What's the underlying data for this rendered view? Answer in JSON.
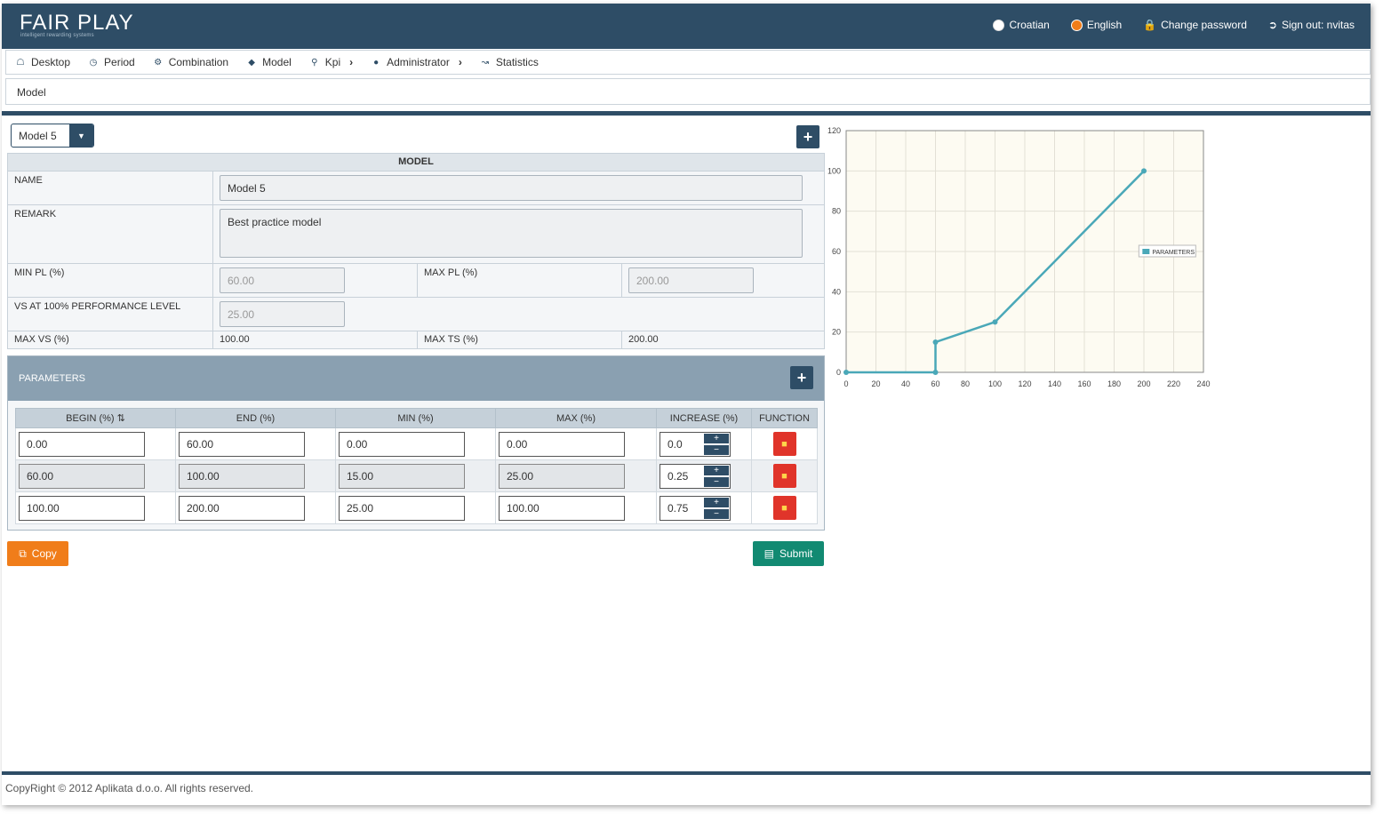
{
  "app": {
    "logo": "FAIR PLAY",
    "logo_sub": "intelligent rewarding systems"
  },
  "header": {
    "lang_croatian": "Croatian",
    "lang_english": "English",
    "change_password": "Change password",
    "sign_out": "Sign out: nvitas"
  },
  "menu": {
    "desktop": "Desktop",
    "period": "Period",
    "combination": "Combination",
    "model": "Model",
    "kpi": "Kpi",
    "administrator": "Administrator",
    "statistics": "Statistics"
  },
  "breadcrumb": "Model",
  "model_select": {
    "value": "Model 5"
  },
  "model_table": {
    "title": "MODEL",
    "name_label": "NAME",
    "name_value": "Model 5",
    "remark_label": "REMARK",
    "remark_value": "Best practice model",
    "min_pl_label": "MIN PL (%)",
    "min_pl_value": "60.00",
    "max_pl_label": "MAX PL (%)",
    "max_pl_value": "200.00",
    "vs_label": "VS AT 100% PERFORMANCE LEVEL",
    "vs_value": "25.00",
    "max_vs_label": "MAX VS (%)",
    "max_vs_value": "100.00",
    "max_ts_label": "MAX TS (%)",
    "max_ts_value": "200.00"
  },
  "parameters": {
    "title": "PARAMETERS",
    "columns": {
      "begin": "BEGIN (%)",
      "end": "END (%)",
      "min": "MIN (%)",
      "max": "MAX (%)",
      "increase": "INCREASE (%)",
      "function": "FUNCTION"
    },
    "rows": [
      {
        "begin": "0.00",
        "end": "60.00",
        "min": "0.00",
        "max": "0.00",
        "increase": "0.0"
      },
      {
        "begin": "60.00",
        "end": "100.00",
        "min": "15.00",
        "max": "25.00",
        "increase": "0.25"
      },
      {
        "begin": "100.00",
        "end": "200.00",
        "min": "25.00",
        "max": "100.00",
        "increase": "0.75"
      }
    ]
  },
  "buttons": {
    "copy": "Copy",
    "submit": "Submit"
  },
  "chart_data": {
    "type": "line",
    "series": [
      {
        "name": "PARAMETERS",
        "x": [
          0,
          60,
          60,
          100,
          200
        ],
        "y": [
          0,
          0,
          15,
          25,
          100
        ]
      }
    ],
    "xlim": [
      0,
      240
    ],
    "ylim": [
      0,
      120
    ],
    "xticks": [
      0,
      20,
      40,
      60,
      80,
      100,
      120,
      140,
      160,
      180,
      200,
      220,
      240
    ],
    "yticks": [
      0,
      20,
      40,
      60,
      80,
      100,
      120
    ],
    "grid": true,
    "legend": "right",
    "color": "#4aa8b8"
  },
  "footer": "CopyRight © 2012 Aplikata d.o.o. All rights reserved."
}
